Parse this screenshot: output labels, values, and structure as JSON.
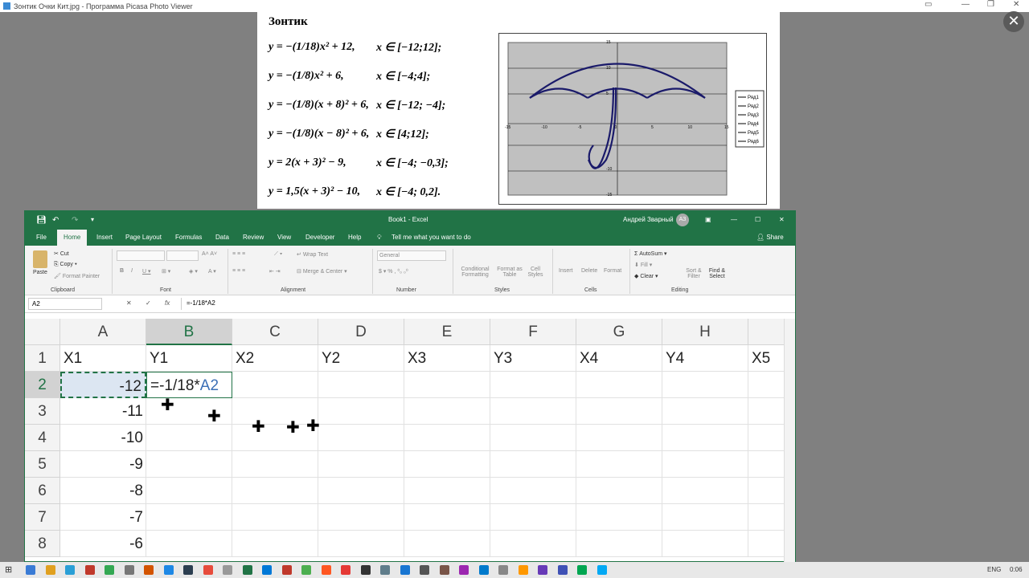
{
  "picasa": {
    "title": "Зонтик Очки Кит.jpg - Программа Picasa Photo Viewer",
    "close_glyph": "✕"
  },
  "photo": {
    "heading": "Зонтик",
    "equations": [
      {
        "eq": "y = −(1/18)x² + 12,",
        "range": "x ∈ [−12;12];"
      },
      {
        "eq": "y = −(1/8)x² + 6,",
        "range": "x ∈ [−4;4];"
      },
      {
        "eq": "y = −(1/8)(x + 8)² + 6,",
        "range": "x ∈ [−12; −4];"
      },
      {
        "eq": "y = −(1/8)(x − 8)² + 6,",
        "range": "x ∈ [4;12];"
      },
      {
        "eq": "y = 2(x + 3)² − 9,",
        "range": "x ∈ [−4; −0,3];"
      },
      {
        "eq": "y = 1,5(x + 3)² − 10,",
        "range": "x ∈ [−4; 0,2]."
      }
    ],
    "chart_legend": [
      "Ряд1",
      "Ряд2",
      "Ряд3",
      "Ряд4",
      "Ряд5",
      "Ряд6"
    ],
    "x_ticks": [
      "-15",
      "-10",
      "-5",
      "0",
      "5",
      "10",
      "15"
    ],
    "y_ticks": [
      "15",
      "10",
      "5",
      "-10",
      "-15"
    ]
  },
  "excel": {
    "file_title": "Book1 - Excel",
    "user": "Андрей Зварный",
    "user_initials": "АЗ",
    "tabs": [
      "File",
      "Home",
      "Insert",
      "Page Layout",
      "Formulas",
      "Data",
      "Review",
      "View",
      "Developer",
      "Help"
    ],
    "tell_me": "Tell me what you want to do",
    "share": "Share",
    "ribbon": {
      "paste": "Paste",
      "cut": "Cut",
      "copy": "Copy",
      "format_painter": "Format Painter",
      "clipboard": "Clipboard",
      "font": "Font",
      "wrap_text": "Wrap Text",
      "merge_center": "Merge & Center",
      "alignment": "Alignment",
      "number_format": "General",
      "number": "Number",
      "conditional": "Conditional Formatting",
      "format_table": "Format as Table",
      "cell_styles": "Cell Styles",
      "styles": "Styles",
      "insert": "Insert",
      "delete": "Delete",
      "format": "Format",
      "cells": "Cells",
      "autosum": "AutoSum",
      "fill": "Fill",
      "clear": "Clear",
      "sort_filter": "Sort & Filter",
      "find_select": "Find & Select",
      "editing": "Editing"
    },
    "name_box": "A2",
    "formula": "=-1/18*A2",
    "columns": [
      "A",
      "B",
      "C",
      "D",
      "E",
      "F",
      "G",
      "H"
    ],
    "rows": [
      "1",
      "2",
      "3",
      "4",
      "5",
      "6",
      "7",
      "8"
    ],
    "headers_row": [
      "X1",
      "Y1",
      "X2",
      "Y2",
      "X3",
      "Y3",
      "X4",
      "Y4",
      "X5"
    ],
    "col_a_values": [
      "-12",
      "-11",
      "-10",
      "-9",
      "-8",
      "-7",
      "-6"
    ],
    "editing_cell_text": "=-1/18*",
    "editing_cell_ref": "A2"
  },
  "taskbar": {
    "lang": "ENG",
    "time": "0:06"
  }
}
